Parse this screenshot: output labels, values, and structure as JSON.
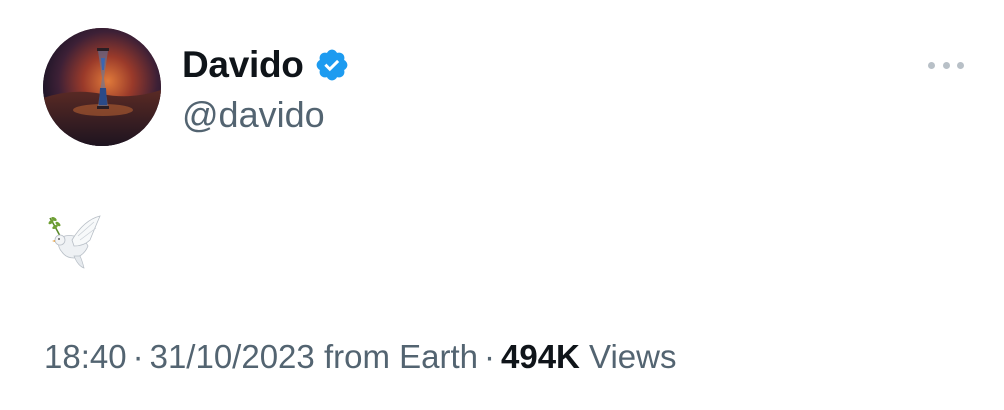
{
  "author": {
    "display_name": "Davido",
    "handle": "@davido",
    "verified": true
  },
  "tweet": {
    "content_icon": "dove-with-olive-branch-icon",
    "time": "18:40",
    "date": "31/10/2023",
    "source": "from Earth",
    "separator": "·",
    "views_count": "494K",
    "views_label": "Views"
  },
  "colors": {
    "verified": "#1d9bf0",
    "secondary_text": "#536471",
    "primary_text": "#0f1419"
  }
}
